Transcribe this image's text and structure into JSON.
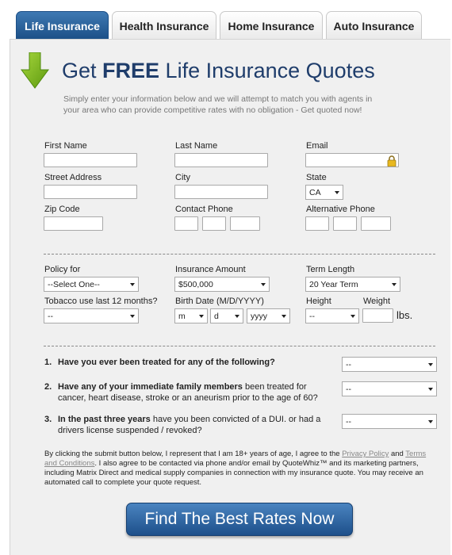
{
  "tabs": [
    {
      "label": "Life Insurance",
      "active": true
    },
    {
      "label": "Health Insurance",
      "active": false
    },
    {
      "label": "Home Insurance",
      "active": false
    },
    {
      "label": "Auto Insurance",
      "active": false
    }
  ],
  "heading": {
    "pre": "Get ",
    "strong": "FREE",
    "post": " Life Insurance Quotes"
  },
  "intro": "Simply enter your information below and we will attempt to match you with agents in your area who can provide competitive rates with no obligation - Get quoted now!",
  "contact": {
    "first_name_label": "First Name",
    "last_name_label": "Last Name",
    "email_label": "Email",
    "street_label": "Street Address",
    "city_label": "City",
    "state_label": "State",
    "state_value": "CA",
    "zip_label": "Zip Code",
    "contact_phone_label": "Contact Phone",
    "alt_phone_label": "Alternative Phone"
  },
  "policy": {
    "policy_for_label": "Policy for",
    "policy_for_value": "--Select One--",
    "amount_label": "Insurance Amount",
    "amount_value": "$500,000",
    "term_label": "Term Length",
    "term_value": "20 Year Term",
    "tobacco_label": "Tobacco use last 12 months?",
    "tobacco_value": "--",
    "birth_label": "Birth Date (M/D/YYYY)",
    "birth_month": "m",
    "birth_day": "d",
    "birth_year": "yyyy",
    "height_label": "Height",
    "height_value": "--",
    "weight_label": "Weight",
    "weight_unit": "lbs."
  },
  "questions": [
    {
      "num": "1.",
      "bold": "Have you ever been treated for any of the following?",
      "rest": "",
      "value": "--"
    },
    {
      "num": "2.",
      "bold": "Have any of your immediate family members",
      "rest": " been treated for cancer, heart disease, stroke or an aneurism prior to the age of 60?",
      "value": "--"
    },
    {
      "num": "3.",
      "bold": "In the past three years",
      "rest": " have you been convicted of a DUI. or had a drivers license suspended / revoked?",
      "value": "--"
    }
  ],
  "legal": {
    "part1": "By clicking the submit button below, I represent that I am 18+ years of age, I agree to the ",
    "privacy_link": "Privacy Policy",
    "part2": " and ",
    "terms_link": "Terms and Conditions",
    "part3": ". I also agree to be contacted via phone and/or email by QuoteWhiz™ and its marketing partners, including Matrix Direct and medical supply companies in connection with my insurance quote. You may receive an automated call to complete your quote request."
  },
  "submit_label": "Find The Best Rates Now",
  "colors": {
    "accent": "#1c4f86",
    "heading": "#1f3d6b",
    "arrow": "#7fba1f",
    "panel": "#f0f0f0"
  },
  "icons": {
    "arrow": "green-down-arrow-icon",
    "lock": "padlock-icon",
    "caret": "chevron-down-icon"
  }
}
